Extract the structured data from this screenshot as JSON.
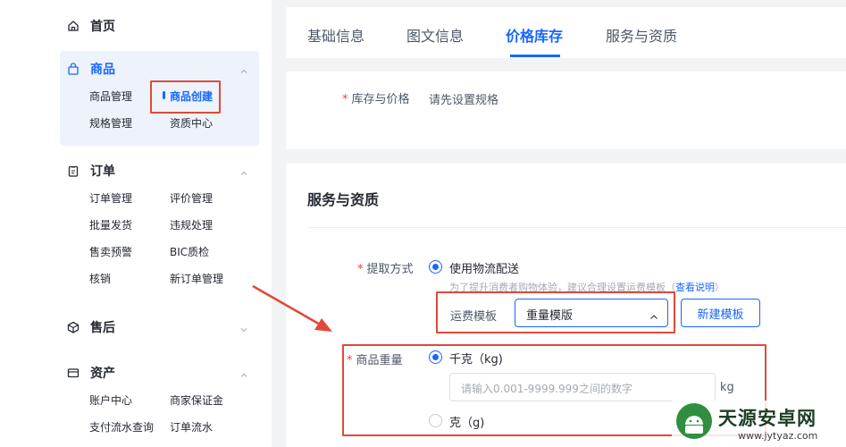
{
  "sidebar": {
    "home": {
      "label": "首页"
    },
    "goods": {
      "label": "商品",
      "items": [
        "商品管理",
        "商品创建",
        "规格管理",
        "资质中心"
      ]
    },
    "orders": {
      "label": "订单",
      "items": [
        "订单管理",
        "评价管理",
        "批量发货",
        "违规处理",
        "售卖预警",
        "BIC质检",
        "核销",
        "新订单管理"
      ]
    },
    "aftersale": {
      "label": "售后"
    },
    "assets": {
      "label": "资产",
      "items": [
        "账户中心",
        "商家保证金",
        "支付流水查询",
        "订单流水"
      ]
    }
  },
  "tabs": [
    "基础信息",
    "图文信息",
    "价格库存",
    "服务与资质"
  ],
  "active_tab": "价格库存",
  "price_stock": {
    "required_mark": "*",
    "label": "库存与价格",
    "value": "请先设置规格"
  },
  "service": {
    "section_title": "服务与资质",
    "pickup": {
      "required_mark": "*",
      "label": "提取方式",
      "option": "使用物流配送",
      "hint_prefix": "为了提升消费者购物体验，建议合理设置运费模板（",
      "hint_link": "查看说明",
      "hint_suffix": "）",
      "template_label": "运费模板",
      "template_value": "重量模版",
      "new_template_button": "新建模板"
    },
    "weight": {
      "required_mark": "*",
      "label": "商品重量",
      "option_kg": "千克（kg)",
      "input_placeholder": "请输入0.001-9999.999之间的数字",
      "unit": "kg",
      "option_g": "克（g)"
    }
  },
  "watermark": {
    "title": "天源安卓网",
    "url": "www.jytyaz.com"
  },
  "colors": {
    "accent": "#1966ff",
    "highlight_box": "#e0493a",
    "required": "#f04142"
  }
}
